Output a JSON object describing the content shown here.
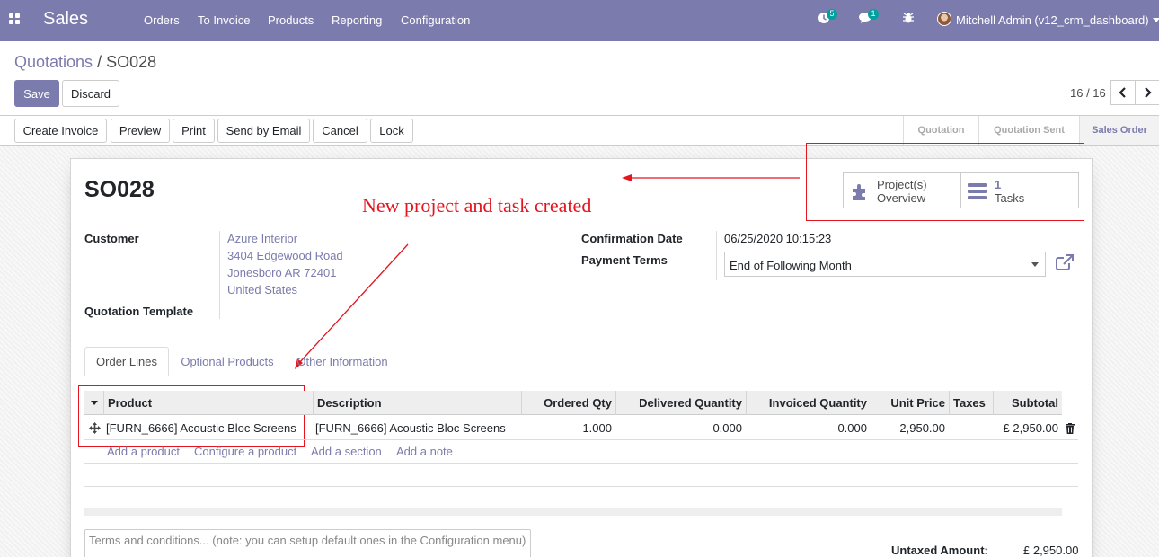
{
  "nav": {
    "app_title": "Sales",
    "menu": [
      "Orders",
      "To Invoice",
      "Products",
      "Reporting",
      "Configuration"
    ],
    "activity_badge": "5",
    "messages_badge": "1",
    "user": "Mitchell Admin (v12_crm_dashboard)"
  },
  "breadcrumb": {
    "parent": "Quotations",
    "separator": " / ",
    "current": "SO028"
  },
  "control": {
    "save": "Save",
    "discard": "Discard",
    "pager": "16 / 16"
  },
  "actions": [
    "Create Invoice",
    "Preview",
    "Print",
    "Send by Email",
    "Cancel",
    "Lock"
  ],
  "stages": [
    "Quotation",
    "Quotation Sent",
    "Sales Order"
  ],
  "form": {
    "name": "SO028",
    "annotation": "New project and task created",
    "smart_buttons": {
      "project_line1": "Project(s)",
      "project_line2": "Overview",
      "tasks_count": "1",
      "tasks_label": "Tasks"
    },
    "customer_label": "Customer",
    "address": [
      "Azure Interior",
      "3404 Edgewood Road",
      "Jonesboro AR 72401",
      "United States"
    ],
    "template_label": "Quotation Template",
    "confirmation_label": "Confirmation Date",
    "confirmation_value": "06/25/2020 10:15:23",
    "payment_terms_label": "Payment Terms",
    "payment_terms_value": "End of Following Month"
  },
  "tabs": [
    "Order Lines",
    "Optional Products",
    "Other Information"
  ],
  "table": {
    "headers": [
      "Product",
      "Description",
      "Ordered Qty",
      "Delivered Quantity",
      "Invoiced Quantity",
      "Unit Price",
      "Taxes",
      "Subtotal"
    ],
    "row": {
      "product": "[FURN_6666] Acoustic Bloc Screens",
      "description": "[FURN_6666] Acoustic Bloc Screens",
      "ordered": "1.000",
      "delivered": "0.000",
      "invoiced": "0.000",
      "unit_price": "2,950.00",
      "taxes": "",
      "subtotal": "£ 2,950.00"
    },
    "add_links": [
      "Add a product",
      "Configure a product",
      "Add a section",
      "Add a note"
    ]
  },
  "terms_placeholder": "Terms and conditions... (note: you can setup default ones in the Configuration menu)",
  "totals": {
    "untaxed_label": "Untaxed Amount:",
    "untaxed_value": "£ 2,950.00"
  },
  "colors": {
    "brand": "#7c7bad",
    "annotation": "#e4151f",
    "badge": "#00a09d"
  }
}
